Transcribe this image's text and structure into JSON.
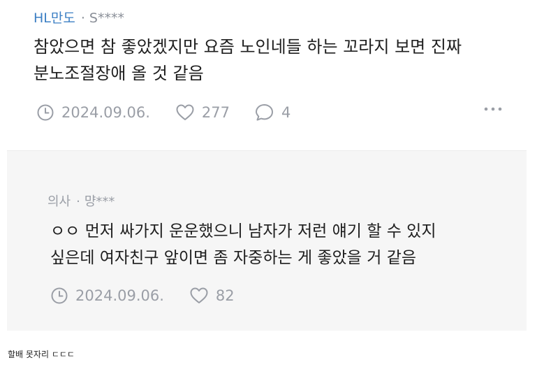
{
  "comment": {
    "author": "HL만도",
    "separator": "·",
    "user": "S****",
    "text_line1": "참았으면 참 좋았겠지만 요즘 노인네들 하는 꼬라지 보면 진짜",
    "text_line2": "분노조절장애 올 것 같음",
    "date": "2024.09.06.",
    "likes": "277",
    "replies": "4",
    "icons": {
      "date": "clock-icon",
      "likes": "heart-icon",
      "replies": "speech-bubble-icon",
      "more": "more-dots-icon"
    }
  },
  "reply": {
    "author": "의사",
    "separator": "·",
    "user": "먕***",
    "text_line1": "ㅇㅇ 먼저 싸가지 운운했으니 남자가 저런 얘기 할 수 있지",
    "text_line2": "싶은데 여자친구 앞이면 좀 자중하는 게 좋았을 거 같음",
    "date": "2024.09.06.",
    "likes": "82"
  },
  "caption": "할배 못자리 ㄷㄷㄷ",
  "colors": {
    "author_link": "#3c7fc4",
    "muted": "#9a9ea6",
    "reply_bg": "#f6f6f6"
  }
}
